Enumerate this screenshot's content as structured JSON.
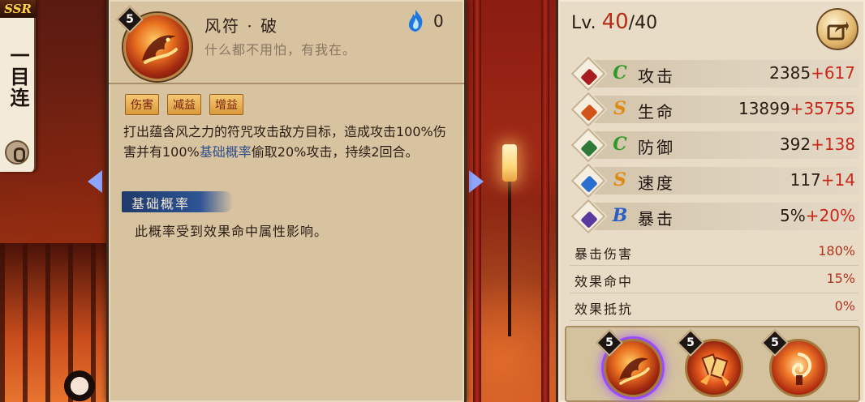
{
  "left_rail": {
    "rarity": "SSR",
    "character_name": "一目连"
  },
  "skill_detail": {
    "level": "5",
    "name": "风符 · 破",
    "quote": "什么都不用怕，有我在。",
    "cost_icon": "soul-fire-icon",
    "cost": "0",
    "tags": [
      "伤害",
      "减益",
      "增益"
    ],
    "description_parts": [
      "打出蕴含风之力的符咒攻击敌方目标，造成攻击100%伤害并有100%",
      "基础概率",
      "偷取20%攻击，持续2回合。"
    ],
    "term_title": "基础概率",
    "term_description": "此概率受到效果命中属性影响。",
    "accent_colors": {
      "keyword": "#2f4f8a",
      "banner": "#2e5494"
    }
  },
  "stats": {
    "level_label": "Lv.",
    "level_current": "40",
    "level_max": "/40",
    "main": [
      {
        "icon": "attack-icon",
        "grade": "C",
        "label": "攻击",
        "base": "2385",
        "bonus": "+617"
      },
      {
        "icon": "health-icon",
        "grade": "S",
        "label": "生命",
        "base": "13899",
        "bonus": "+35755"
      },
      {
        "icon": "defense-icon",
        "grade": "C",
        "label": "防御",
        "base": "392",
        "bonus": "+138"
      },
      {
        "icon": "speed-icon",
        "grade": "S",
        "label": "速度",
        "base": "117",
        "bonus": "+14"
      },
      {
        "icon": "crit-icon",
        "grade": "B",
        "label": "暴击",
        "base": "5%",
        "bonus": "+20%"
      }
    ],
    "secondary": [
      {
        "label": "暴击伤害",
        "value": "180%"
      },
      {
        "label": "效果命中",
        "value": "15%"
      },
      {
        "label": "效果抵抗",
        "value": "0%"
      }
    ],
    "grade_colors": {
      "C": "#2f9a2a",
      "S": "#e08a16",
      "B": "#2a5fc8"
    }
  },
  "skill_bar": {
    "slots": [
      {
        "level": "5",
        "icon": "fire-dragon-skill-icon",
        "selected": true
      },
      {
        "level": "5",
        "icon": "talisman-burst-skill-icon",
        "selected": false
      },
      {
        "level": "5",
        "icon": "wind-spirit-skill-icon",
        "selected": false
      }
    ]
  }
}
